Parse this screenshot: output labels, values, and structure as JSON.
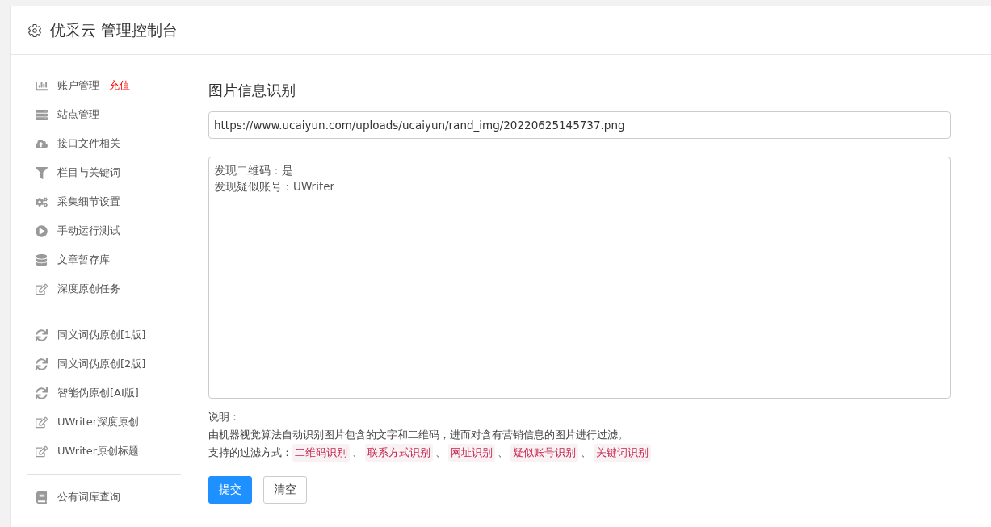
{
  "header": {
    "title": "优采云 管理控制台"
  },
  "sidebar": {
    "groups": [
      {
        "items": [
          {
            "label": "账户管理",
            "badge": "充值"
          },
          {
            "label": "站点管理"
          },
          {
            "label": "接口文件相关"
          },
          {
            "label": "栏目与关键词"
          },
          {
            "label": "采集细节设置"
          },
          {
            "label": "手动运行测试"
          },
          {
            "label": "文章暂存库"
          },
          {
            "label": "深度原创任务"
          }
        ]
      },
      {
        "items": [
          {
            "label": "同义词伪原创[1版]"
          },
          {
            "label": "同义词伪原创[2版]"
          },
          {
            "label": "智能伪原创[AI版]"
          },
          {
            "label": "UWriter深度原创"
          },
          {
            "label": "UWriter原创标题"
          }
        ]
      },
      {
        "items": [
          {
            "label": "公有词库查询"
          }
        ]
      }
    ]
  },
  "main": {
    "heading": "图片信息识别",
    "url_field": {
      "value": "https://www.ucaiyun.com/uploads/ucaiyun/rand_img/20220625145737.png"
    },
    "result_lines": [
      "发现二维码：是",
      "发现疑似账号：UWriter"
    ],
    "note_label": "说明：",
    "note_text": "由机器视觉算法自动识别图片包含的文字和二维码，进而对含有营销信息的图片进行过滤。",
    "filters_label": "支持的过滤方式：",
    "filters": [
      "二维码识别",
      "联系方式识别",
      "网址识别",
      "疑似账号识别",
      "关键词识别"
    ],
    "separators": [
      "、",
      "、",
      "、",
      "、"
    ],
    "buttons": [
      {
        "label": "提交",
        "kind": "primary"
      },
      {
        "label": "清空",
        "kind": "default"
      }
    ]
  }
}
